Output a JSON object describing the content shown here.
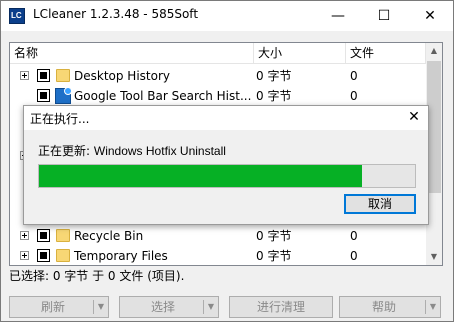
{
  "window": {
    "title": "LCleaner 1.2.3.48 - 585Soft",
    "minimize": "—",
    "maximize": "☐",
    "close": "✕"
  },
  "list": {
    "columns": [
      "名称",
      "大小",
      "文件"
    ],
    "rows": [
      {
        "name": "Desktop History",
        "size": "0 字节",
        "files": "0"
      },
      {
        "name": "Google Tool Bar Search Hist...",
        "size": "0 字节",
        "files": "0"
      },
      {
        "name": "Recycle Bin",
        "size": "0 字节",
        "files": "0"
      },
      {
        "name": "Temporary Files",
        "size": "0 字节",
        "files": "0"
      }
    ]
  },
  "status": "已选择: 0 字节 于 0 文件 (项目).",
  "buttons": {
    "refresh": "刷新",
    "select": "选择",
    "clean": "进行清理",
    "help": "帮助"
  },
  "dialog": {
    "title": "正在执行...",
    "close": "✕",
    "message_prefix": "正在更新:",
    "message_item": "Windows Hotfix Uninstall",
    "progress": 0.86,
    "cancel": "取消"
  }
}
